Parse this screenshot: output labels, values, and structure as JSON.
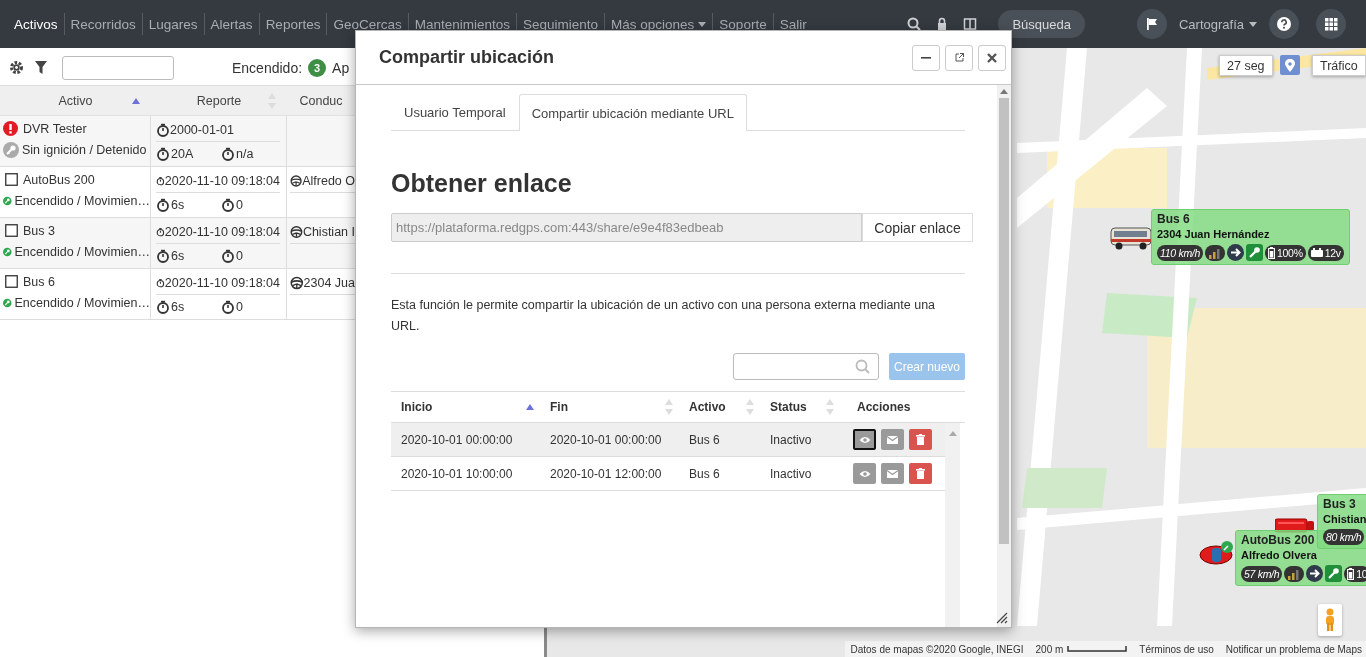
{
  "navbar": {
    "items": [
      {
        "label": "Activos",
        "selected": true,
        "kind": "link"
      },
      {
        "label": "Recorridos",
        "selected": false,
        "kind": "link"
      },
      {
        "label": "Lugares",
        "selected": false,
        "kind": "link"
      },
      {
        "label": "Alertas",
        "selected": false,
        "kind": "link"
      },
      {
        "label": "Reportes",
        "selected": false,
        "kind": "link"
      },
      {
        "label": "GeoCercas",
        "selected": false,
        "kind": "link"
      },
      {
        "label": "Mantenimientos",
        "selected": false,
        "kind": "link"
      },
      {
        "label": "Seguimiento",
        "selected": false,
        "kind": "link"
      },
      {
        "label": "Más opciones",
        "selected": false,
        "kind": "dropdown"
      },
      {
        "label": "Soporte",
        "selected": false,
        "kind": "link"
      },
      {
        "label": "Salir",
        "selected": false,
        "kind": "link"
      }
    ],
    "search_button": "Búsqueda",
    "map_menu": "Cartografía"
  },
  "assets": {
    "summary": {
      "label": "Encendido:",
      "count": "3",
      "next": "Ap"
    },
    "columns": [
      {
        "label": "Activo",
        "sorted": true
      },
      {
        "label": "Reporte",
        "sorted": false
      },
      {
        "label": "Conduc"
      }
    ],
    "rows": [
      {
        "alert": true,
        "name": "DVR Tester",
        "ignition_on": false,
        "status": "Sin ignición / Detenido",
        "report_time": "2000-01-01",
        "report_a": "20A",
        "report_b": "n/a"
      },
      {
        "alert": false,
        "name": "AutoBus 200",
        "ignition_on": true,
        "status": "Encendido / Movimien…",
        "report_time": "2020-11-10 09:18:04",
        "report_a": "6s",
        "report_b": "0",
        "driver": "Alfredo O"
      },
      {
        "alert": false,
        "name": "Bus 3",
        "ignition_on": true,
        "status": "Encendido / Movimien…",
        "report_time": "2020-11-10 09:18:04",
        "report_a": "6s",
        "report_b": "0",
        "driver": "Chistian I"
      },
      {
        "alert": false,
        "name": "Bus 6",
        "ignition_on": true,
        "status": "Encendido / Movimien…",
        "report_time": "2020-11-10 09:18:04",
        "report_a": "6s",
        "report_b": "0",
        "driver": "2304 Jua"
      }
    ]
  },
  "map": {
    "refresh": "27 seg",
    "traffic": "Tráfico",
    "vehicles": [
      {
        "kind": "bus",
        "name": "Bus 6",
        "driver": "2304 Juan Hernández",
        "speed": "110 km/h",
        "battery": "100%",
        "voltage": "12v"
      },
      {
        "kind": "truck",
        "name": "Bus 3",
        "driver": "Chistian",
        "speed": "80 km/h"
      },
      {
        "kind": "car",
        "name": "AutoBus 200",
        "driver": "Alfredo Olvera",
        "speed": "57 km/h",
        "battery": "10"
      }
    ],
    "attribution": {
      "data": "Datos de mapas ©2020 Google, INEGI",
      "scale": "200 m",
      "terms": "Términos de uso",
      "report": "Notificar un problema de Maps"
    }
  },
  "modal": {
    "title": "Compartir ubicación",
    "tabs": [
      {
        "label": "Usuario Temporal",
        "selected": false
      },
      {
        "label": "Compartir ubicación mediante URL",
        "selected": true
      }
    ],
    "heading": "Obtener enlace",
    "link_url": "https://plataforma.redgps.com:443/share/e9e4f83edbeab",
    "copy_button": "Copiar enlace",
    "description": "Esta función le permite compartir la ubicación de un activo con una persona externa mediante una URL.",
    "create_button": {
      "label": "Crear nuevo",
      "disabled": true
    },
    "columns": [
      {
        "label": "Inicio",
        "sorted": true
      },
      {
        "label": "Fin",
        "sorted": false
      },
      {
        "label": "Activo",
        "sorted": false
      },
      {
        "label": "Status",
        "sorted": false
      },
      {
        "label": "Acciones"
      }
    ],
    "rows": [
      {
        "start": "2020-10-01 00:00:00",
        "end": "2020-10-01 00:00:00",
        "asset": "Bus 6",
        "status": "Inactivo",
        "selected": true
      },
      {
        "start": "2020-10-01 10:00:00",
        "end": "2020-10-01 12:00:00",
        "asset": "Bus 6",
        "status": "Inactivo",
        "selected": false
      }
    ]
  }
}
